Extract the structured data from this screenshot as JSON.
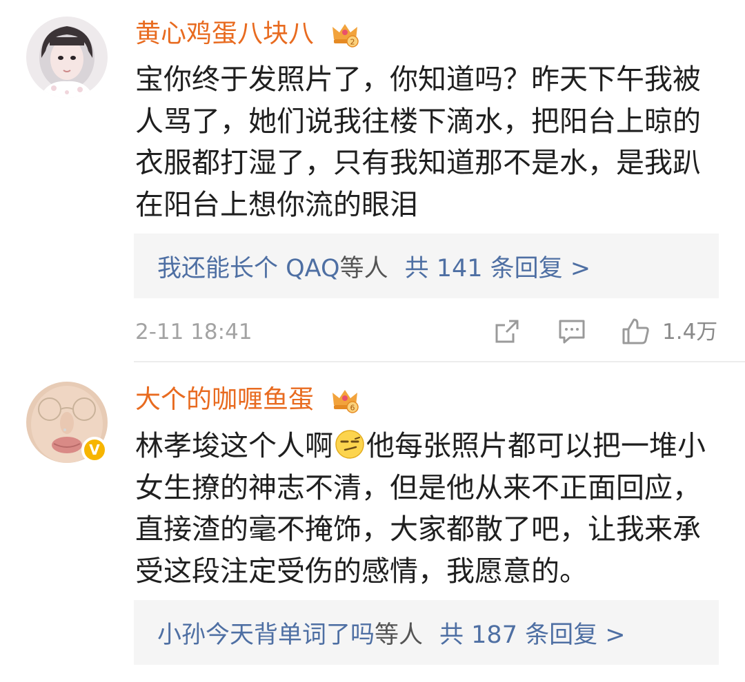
{
  "comments": [
    {
      "username": "黄心鸡蛋八块八",
      "crown_level": "2",
      "text": "宝你终于发照片了，你知道吗？昨天下午我被人骂了，她们说我往楼下滴水，把阳台上晾的衣服都打湿了，只有我知道那不是水，是我趴在阳台上想你流的眼泪",
      "reply_users": "我还能长个 QAQ",
      "reply_mid": "等人",
      "reply_count": "共 141 条回复 >",
      "time": "2-11 18:41",
      "likes": "1.4万",
      "icons": [
        "share-icon",
        "comment-icon",
        "like-icon"
      ]
    },
    {
      "username": "大个的咖喱鱼蛋",
      "crown_level": "6",
      "verified_badge": "V",
      "text_before_emoji": "林孝埈这个人啊",
      "emoji": "smirk-emoji",
      "text_after_emoji": "他每张照片都可以把一堆小女生撩的神志不清，但是他从来不正面回应，直接渣的毫不掩饰，大家都散了吧，让我来承受这段注定受伤的感情，我愿意的。",
      "reply_users": "小孙今天背单词了吗",
      "reply_mid": "等人",
      "reply_count": "共 187 条回复 >"
    }
  ],
  "colors": {
    "username": "#e86b20",
    "body_text": "#1f1f1f",
    "reply_link": "#4e6fa3",
    "reply_bg": "#f5f5f5",
    "meta_gray": "#a3a3a3",
    "verified": "#f7b500"
  }
}
